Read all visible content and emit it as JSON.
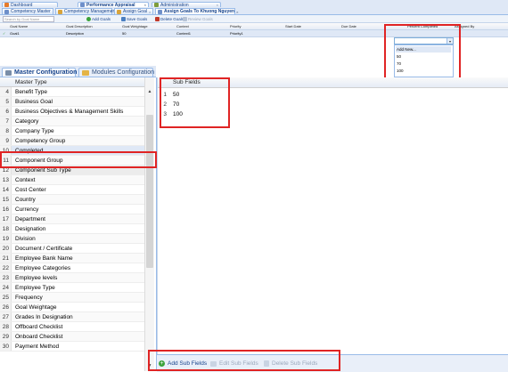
{
  "top_tabs": [
    {
      "label": "Dashboard",
      "color": "#e57a2a"
    },
    {
      "label": "Performance Appraisal",
      "color": "#6e8fc9"
    },
    {
      "label": "Administration",
      "color": "#7e9c3b"
    }
  ],
  "sub_tabs": [
    {
      "label": "Competency Master"
    },
    {
      "label": "Competency Management"
    },
    {
      "label": "Assign Goal"
    },
    {
      "label": "Assign Goals To Khuong Nguyen"
    }
  ],
  "toolbar": {
    "search_placeholder": "Search by Goal Name",
    "add_goals": "Add Goals",
    "save_goals": "Save Goals",
    "delete_goals": "Delete Goals",
    "review_goals": "Review Goals"
  },
  "goal_grid": {
    "headers": [
      "Goal Name",
      "Goal Description",
      "Goal Weightage",
      "Context",
      "Priority",
      "Start Date",
      "Due Date",
      "Percent Completed",
      "Assigned By"
    ],
    "row": [
      "Goal1",
      "Description",
      "50",
      "Context1",
      "Priority1",
      "",
      "",
      "",
      ""
    ]
  },
  "percent_dropdown": {
    "current_value": "",
    "options": [
      "Add New...",
      "50",
      "70",
      "100"
    ]
  },
  "config_tabs": [
    {
      "label": "Master Configuration",
      "active": true
    },
    {
      "label": "Modules Configuration",
      "active": false
    }
  ],
  "master_list": {
    "header": "Master Type",
    "rows": [
      {
        "num": "4",
        "label": "Benefit Type"
      },
      {
        "num": "5",
        "label": "Business Goal"
      },
      {
        "num": "6",
        "label": "Business Objectives & Management Skills"
      },
      {
        "num": "7",
        "label": "Category"
      },
      {
        "num": "8",
        "label": "Company Type"
      },
      {
        "num": "9",
        "label": "Competency Group"
      },
      {
        "num": "10",
        "label": "Completed"
      },
      {
        "num": "11",
        "label": "Component Group"
      },
      {
        "num": "12",
        "label": "Component Sub Type"
      },
      {
        "num": "13",
        "label": "Context"
      },
      {
        "num": "14",
        "label": "Cost Center"
      },
      {
        "num": "15",
        "label": "Country"
      },
      {
        "num": "16",
        "label": "Currency"
      },
      {
        "num": "17",
        "label": "Department"
      },
      {
        "num": "18",
        "label": "Designation"
      },
      {
        "num": "19",
        "label": "Division"
      },
      {
        "num": "20",
        "label": "Document / Certificate"
      },
      {
        "num": "21",
        "label": "Employee Bank Name"
      },
      {
        "num": "22",
        "label": "Employee Categories"
      },
      {
        "num": "23",
        "label": "Employee levels"
      },
      {
        "num": "24",
        "label": "Employee Type"
      },
      {
        "num": "25",
        "label": "Frequency"
      },
      {
        "num": "26",
        "label": "Goal Weightage"
      },
      {
        "num": "27",
        "label": "Grades In Designation"
      },
      {
        "num": "28",
        "label": "Offboard Checklist"
      },
      {
        "num": "29",
        "label": "Onboard Checklist"
      },
      {
        "num": "30",
        "label": "Payment Method"
      }
    ]
  },
  "sub_fields": {
    "header": "Sub Fields",
    "rows": [
      {
        "num": "1",
        "label": "50"
      },
      {
        "num": "2",
        "label": "70"
      },
      {
        "num": "3",
        "label": "100"
      }
    ]
  },
  "bottom_toolbar": {
    "add": "Add Sub Fields",
    "edit": "Edit Sub Fields",
    "delete": "Delete Sub Fields"
  },
  "colors": {
    "highlight": "#e02424",
    "selection": "#dfe8f6",
    "accent": "#15428b"
  }
}
